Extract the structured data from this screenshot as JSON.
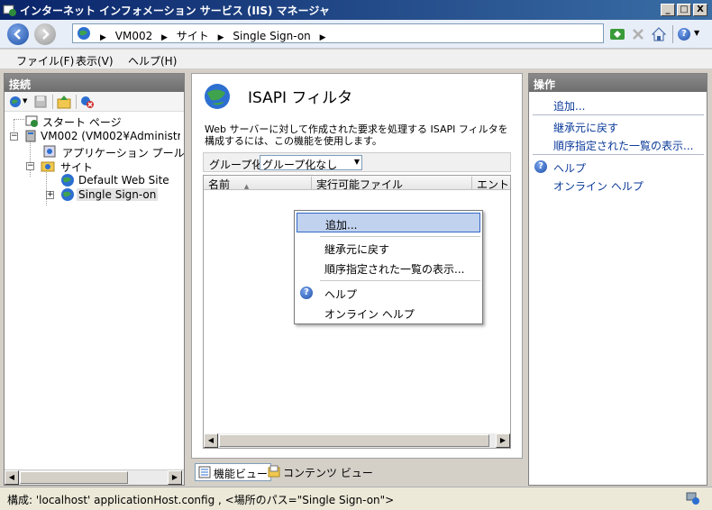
{
  "window": {
    "title": "インターネット インフォメーション サービス (IIS) マネージャ",
    "minimize_glyph": "_",
    "maximize_glyph": "□",
    "close_glyph": "X"
  },
  "address": {
    "crumbs": [
      "VM002",
      "サイト",
      "Single Sign-on"
    ],
    "dropdown_glyph": "▼"
  },
  "menu": [
    "ファイル(F)",
    "表示(V)",
    "ヘルプ(H)"
  ],
  "connections": {
    "header": "接続",
    "tree": [
      {
        "label": "スタート ページ",
        "icon": "start-page-icon"
      },
      {
        "label": "VM002 (VM002¥Administrator)",
        "icon": "server-icon",
        "expander": "−"
      },
      {
        "label": "アプリケーション プール",
        "icon": "app-pool-icon"
      },
      {
        "label": "サイト",
        "icon": "folder-icon",
        "expander": "−"
      },
      {
        "label": "Default Web Site",
        "icon": "globe-icon"
      },
      {
        "label": "Single Sign-on",
        "icon": "globe-icon",
        "expander": "+",
        "selected": true
      }
    ]
  },
  "feature": {
    "title": "ISAPI フィルタ",
    "description": "Web サーバーに対して作成された要求を処理する ISAPI フィルタを構成するには、この機能を使用します。",
    "groupby_label": "グループ化:",
    "groupby_value": "グループ化なし",
    "columns": [
      "名前",
      "実行可能ファイル",
      "エントリ"
    ]
  },
  "view_tabs": {
    "features": "機能ビュー",
    "content": "コンテンツ ビュー"
  },
  "actions": {
    "header": "操作",
    "add": "追加...",
    "revert": "継承元に戻す",
    "view_ordered": "順序指定された一覧の表示...",
    "help": "ヘルプ",
    "online_help": "オンライン ヘルプ"
  },
  "context_menu": {
    "add": "追加...",
    "revert": "継承元に戻す",
    "view_ordered": "順序指定された一覧の表示...",
    "help": "ヘルプ",
    "online_help": "オンライン ヘルプ"
  },
  "status": {
    "text": "構成: 'localhost' applicationHost.config , <場所のパス=\"Single Sign-on\">"
  },
  "colors": {
    "title_bar": "#0a246a",
    "link": "#0b3a9a",
    "selection": "#c1d2ee"
  }
}
